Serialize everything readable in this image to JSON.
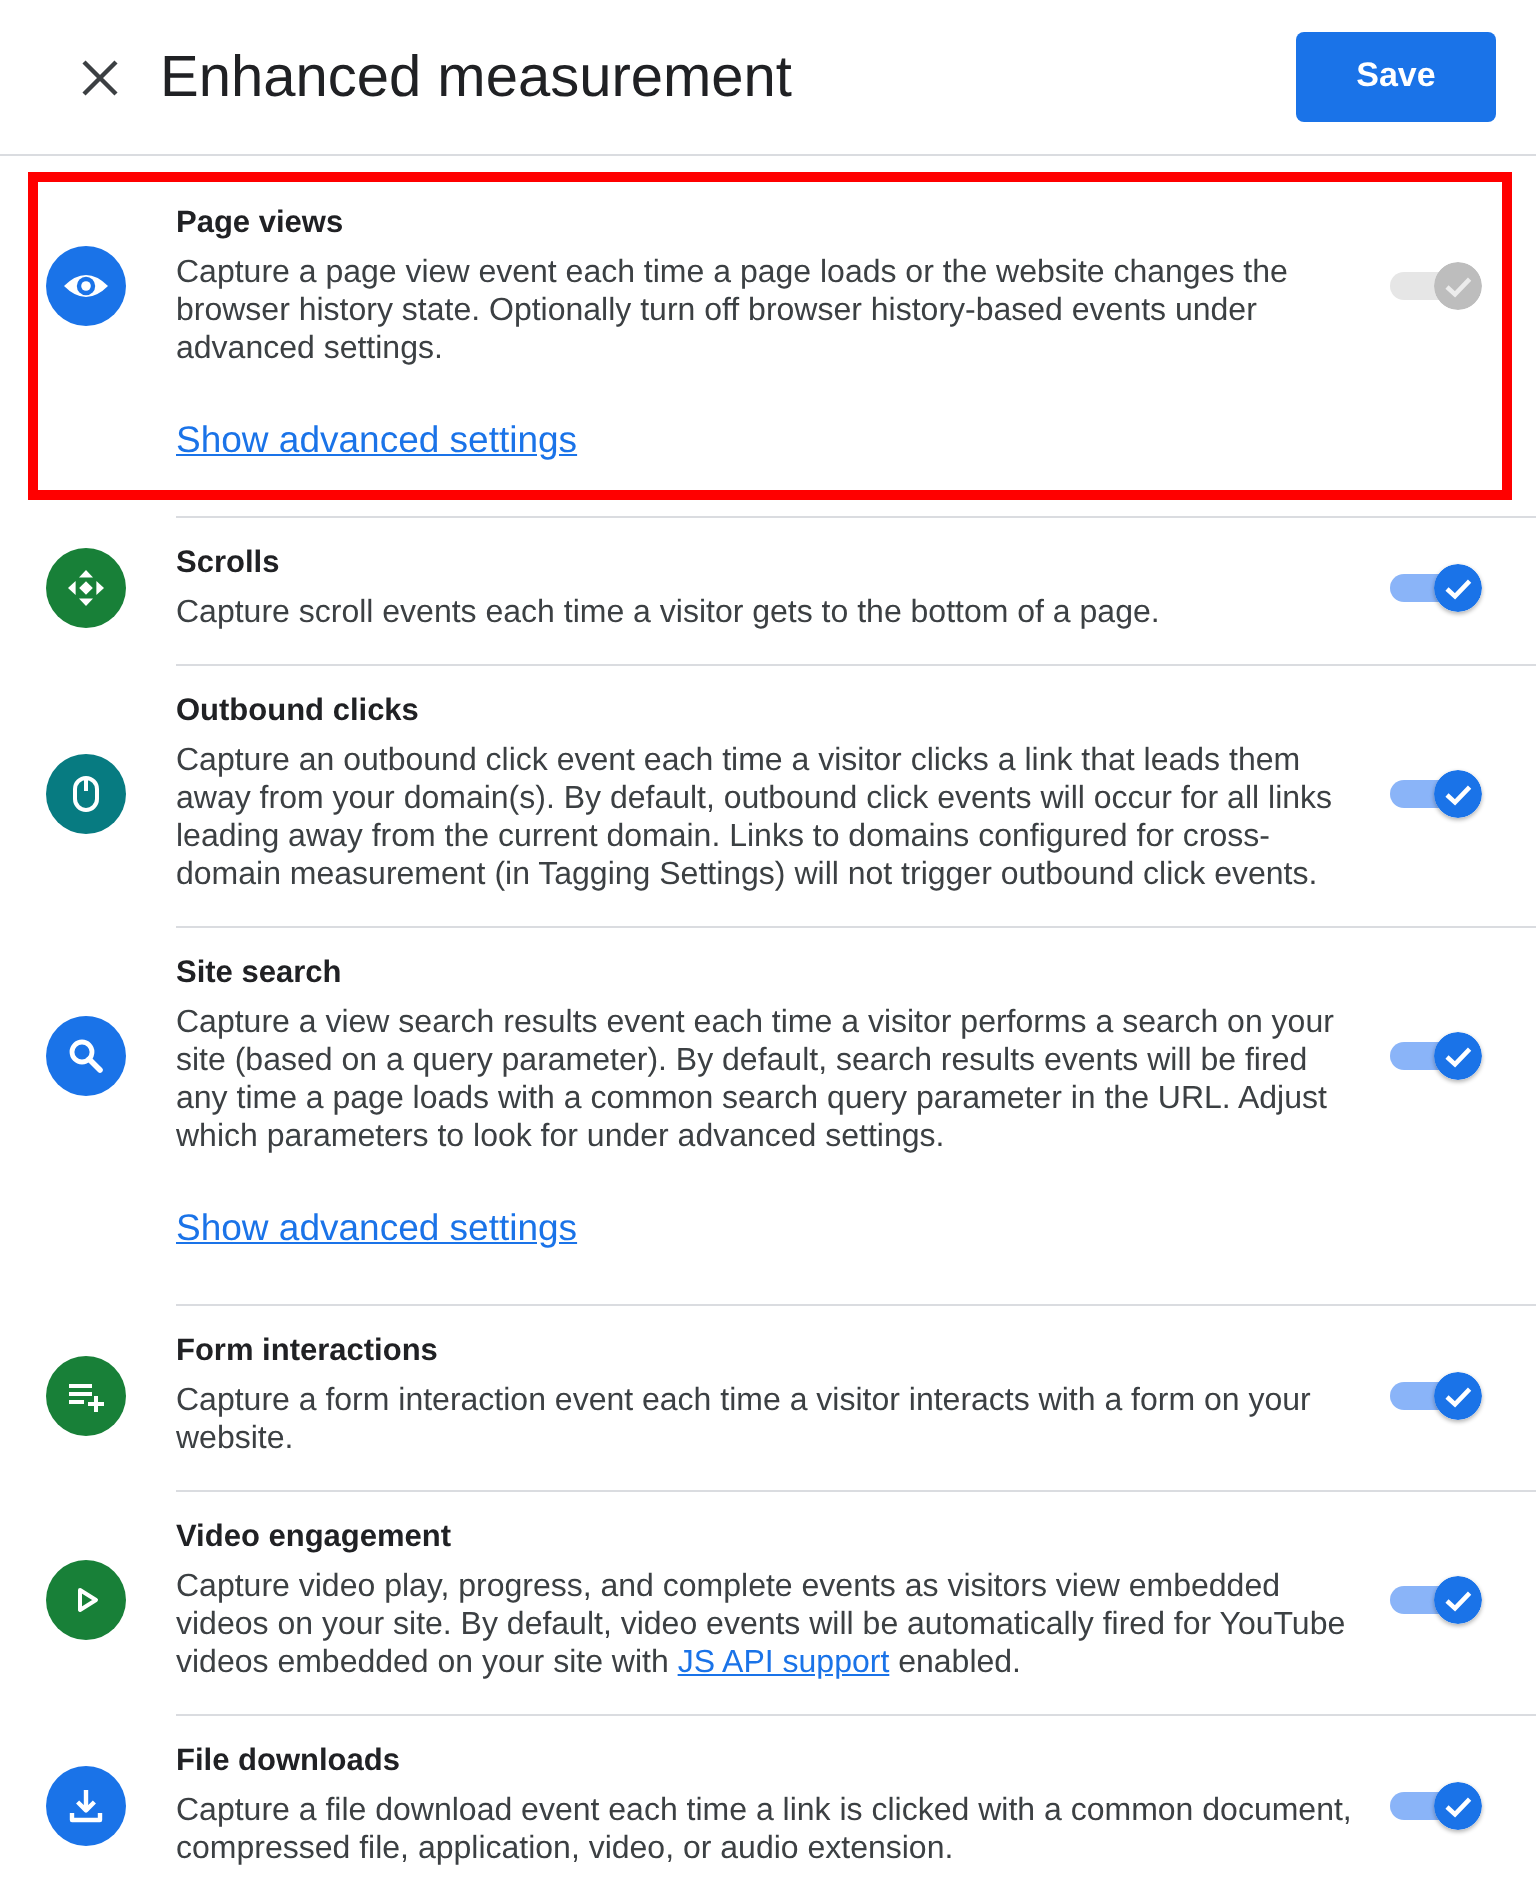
{
  "header": {
    "title": "Enhanced measurement",
    "save_button": "Save"
  },
  "settings": [
    {
      "title": "Page views",
      "description": [
        {
          "kind": "text",
          "text": "Capture a page view event each time a page loads or the website changes the browser history state. Optionally turn off browser history-based events under advanced settings."
        }
      ],
      "link": "Show advanced settings",
      "color": "#1a73e8",
      "on": true,
      "disabled": true,
      "highlighted": true
    },
    {
      "title": "Scrolls",
      "description": [
        {
          "kind": "text",
          "text": "Capture scroll events each time a visitor gets to the bottom of a page."
        }
      ],
      "color": "#188038",
      "on": true,
      "disabled": false,
      "highlighted": false
    },
    {
      "title": "Outbound clicks",
      "description": [
        {
          "kind": "text",
          "text": "Capture an outbound click event each time a visitor clicks a link that leads them away from your domain(s). By default, outbound click events will occur for all links leading away from the current domain. Links to domains configured for cross-domain measurement (in Tagging Settings) will not trigger outbound click events."
        }
      ],
      "color": "#077b81",
      "on": true,
      "disabled": false,
      "highlighted": false
    },
    {
      "title": "Site search",
      "description": [
        {
          "kind": "text",
          "text": "Capture a view search results event each time a visitor performs a search on your site (based on a query parameter). By default, search results events will be fired any time a page loads with a common search query parameter in the URL. Adjust which parameters to look for under advanced settings."
        }
      ],
      "link": "Show advanced settings",
      "color": "#1a73e8",
      "on": true,
      "disabled": false,
      "highlighted": false
    },
    {
      "title": "Form interactions",
      "description": [
        {
          "kind": "text",
          "text": "Capture a form interaction event each time a visitor interacts with a form on your website."
        }
      ],
      "color": "#188038",
      "on": true,
      "disabled": false,
      "highlighted": false
    },
    {
      "title": "Video engagement",
      "description": [
        {
          "kind": "text",
          "text": "Capture video play, progress, and complete events as visitors view embedded videos on your site. By default, video events will be automatically fired for YouTube videos embedded on your site with "
        },
        {
          "kind": "link",
          "text": "JS API support"
        },
        {
          "kind": "text",
          "text": " enabled."
        }
      ],
      "color": "#188038",
      "on": true,
      "disabled": false,
      "highlighted": false
    },
    {
      "title": "File downloads",
      "description": [
        {
          "kind": "text",
          "text": "Capture a file download event each time a link is clicked with a common document, compressed file, application, video, or audio extension."
        }
      ],
      "color": "#1a73e8",
      "on": true,
      "disabled": false,
      "highlighted": false
    }
  ]
}
